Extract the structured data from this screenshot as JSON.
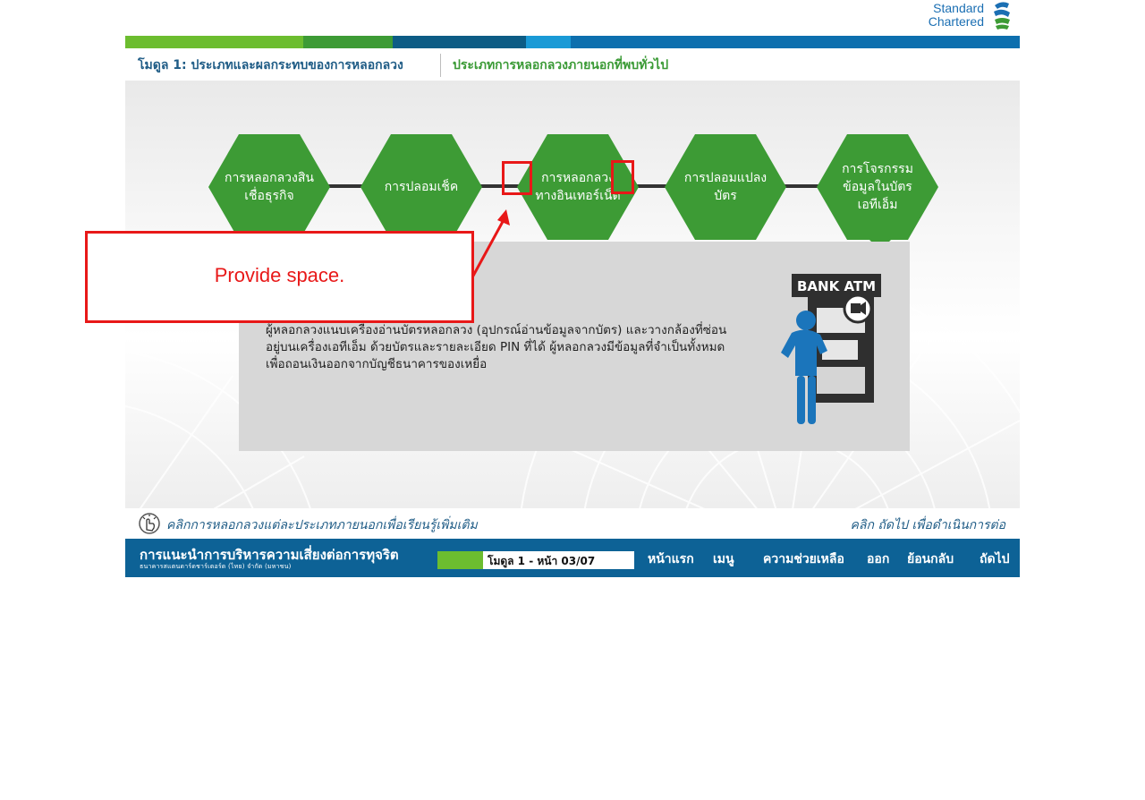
{
  "brand": {
    "line1": "Standard",
    "line2": "Chartered"
  },
  "stripe_colors": [
    "#6cbd2f",
    "#3d9b35",
    "#0d5c85",
    "#1a9ad6",
    "#0d6fae"
  ],
  "breadcrumb": {
    "module": "โมดูล 1: ประเภทและผลกระทบของการหลอกลวง",
    "section": "ประเภทการหลอกลวงภายนอกที่พบทั่วไป"
  },
  "hexagons": [
    {
      "label": "การหลอกลวงสินเชื่อธุรกิจ"
    },
    {
      "label": "การปลอมเช็ค"
    },
    {
      "label": "การหลอกลวงทางอินเทอร์เน็ต"
    },
    {
      "label": "การปลอมแปลงบัตร"
    },
    {
      "label": "การโจรกรรมข้อมูลในบัตรเอทีเอ็ม"
    }
  ],
  "panel": {
    "description": "ผู้หลอกลวงแนบเครื่องอ่านบัตรหลอกลวง (อุปกรณ์อ่านข้อมูลจากบัตร) และวางกล้องที่ซ่อนอยู่บนเครื่องเอทีเอ็ม ด้วยบัตรและรายละเอียด PIN ที่ได้ ผู้หลอกลวงมีข้อมูลที่จำเป็นทั้งหมดเพื่อถอนเงินออกจากบัญชีธนาคารของเหยื่อ",
    "atm_sign": "BANK ATM"
  },
  "annotation": {
    "text": "Provide space."
  },
  "instructions": {
    "left": "คลิกการหลอกลวงแต่ละประเภทภายนอกเพื่อเรียนรู้เพิ่มเติม",
    "right": "คลิก ถัดไป เพื่อดำเนินการต่อ"
  },
  "footer": {
    "title": "การแนะนำการบริหารความเสี่ยงต่อการทุจริต",
    "subtitle": "ธนาคารสแตนดาร์ดชาร์เตอร์ด (ไทย) จำกัด (มหาชน)",
    "progress_label": "โมดูล 1 - หน้า 03/07",
    "progress_fraction": 0.23,
    "nav": [
      "หน้าแรก",
      "เมนู",
      "ความช่วยเหลือ",
      "ออก",
      "ย้อนกลับ",
      "ถัดไป"
    ]
  }
}
